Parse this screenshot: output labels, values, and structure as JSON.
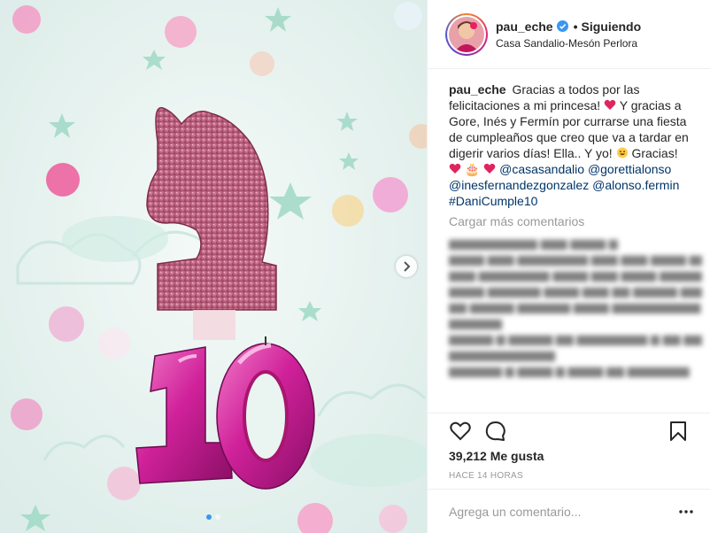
{
  "post": {
    "image_alt_icon": "photo",
    "carousel": {
      "active_index": 0,
      "count": 2
    }
  },
  "header": {
    "username": "pau_eche",
    "bullet": "•",
    "follow_status": "Siguiendo",
    "location": "Casa Sandalio-Mesón Perlora"
  },
  "caption": {
    "username": "pau_eche",
    "text1": "Gracias a todos por las felicitaciones a mi princesa! ",
    "text2": " Y gracias a Gore, Inés y Fermín por currarse una fiesta de cumpleaños que creo que va a tardar en digerir varios días! Ella.. Y yo! ",
    "text3": " Gracias!",
    "cake_emoji": "🎂",
    "smile_emoji": "😃",
    "tags": [
      "@casasandalio",
      "@gorettialonso",
      "@inesfernandezgonzalez",
      "@alonso.fermin",
      "#DaniCumple10"
    ]
  },
  "comments": {
    "load_more": "Cargar más comentarios"
  },
  "stats": {
    "likes": "39,212 Me gusta",
    "time": "HACE 14 HORAS"
  },
  "comment_box": {
    "placeholder": "Agrega un comentario..."
  },
  "colors": {
    "accent_blue": "#3897f0",
    "link": "#003569",
    "verified": "#3897f0",
    "heart_pink": "#e0245e"
  }
}
